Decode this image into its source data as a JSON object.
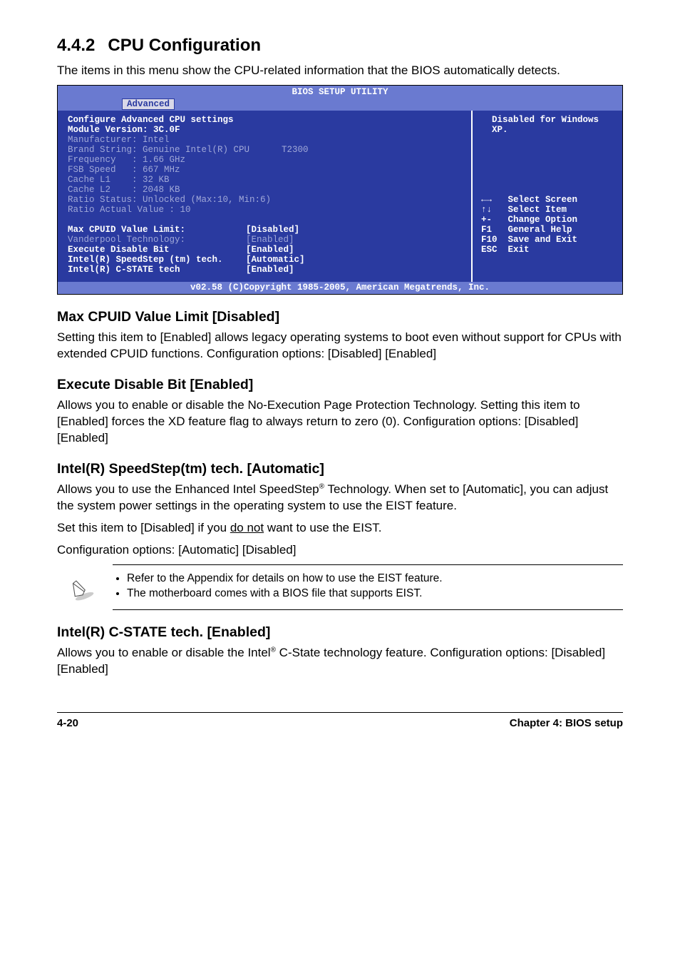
{
  "heading": {
    "num": "4.4.2",
    "title": "CPU Configuration"
  },
  "intro": "The items in this menu show the CPU-related information that the BIOS automatically detects.",
  "bios": {
    "headerTitle": "BIOS SETUP UTILITY",
    "tab": "Advanced",
    "cfg1": "Configure Advanced CPU settings",
    "cfg2": "Module Version: 3C.0F",
    "grey": [
      "Manufacturer: Intel",
      "Brand String: Genuine Intel(R) CPU      T2300",
      "Frequency   : 1.66 GHz",
      "FSB Speed   : 667 MHz",
      "Cache L1    : 32 KB",
      "Cache L2    : 2048 KB",
      "Ratio Status: Unlocked (Max:10, Min:6)",
      "Ratio Actual Value : 10"
    ],
    "rows": [
      {
        "label": "Max CPUID Value Limit:",
        "value": "[Disabled]",
        "style": "white"
      },
      {
        "label": "Vanderpool Technology:",
        "value": "[Enabled]",
        "style": "grey"
      },
      {
        "label": "Execute Disable Bit",
        "value": "[Enabled]",
        "style": "white"
      },
      {
        "label": "Intel(R) SpeedStep (tm) tech.",
        "value": "[Automatic]",
        "style": "white"
      },
      {
        "label": "Intel(R) C-STATE tech",
        "value": "[Enabled]",
        "style": "white"
      }
    ],
    "rightTop": "  Disabled for Windows\n  XP.",
    "rightNav": [
      {
        "key": "←→",
        "text": "Select Screen"
      },
      {
        "key": "↑↓",
        "text": "Select Item"
      },
      {
        "key": "+-",
        "text": "Change Option"
      },
      {
        "key": "F1",
        "text": "General Help"
      },
      {
        "key": "F10",
        "text": "Save and Exit"
      },
      {
        "key": "ESC",
        "text": "Exit"
      }
    ],
    "footer": "v02.58 (C)Copyright 1985-2005, American Megatrends, Inc."
  },
  "s1": {
    "title": "Max CPUID Value Limit [Disabled]",
    "body": "Setting this item to [Enabled] allows legacy operating systems to boot even without support for CPUs with extended CPUID functions. Configuration options: [Disabled] [Enabled]"
  },
  "s2": {
    "title": "Execute Disable Bit [Enabled]",
    "body": "Allows you to enable or disable the No-Execution Page Protection Technology. Setting this item to [Enabled] forces the XD feature flag to always return to zero (0). Configuration options: [Disabled] [Enabled]"
  },
  "s3": {
    "title": "Intel(R) SpeedStep(tm) tech. [Automatic]",
    "p1a": "Allows you to use the Enhanced Intel SpeedStep",
    "p1b": " Technology. When set to [Automatic], you can adjust the system power settings in the operating system to use the EIST feature.",
    "p2a": "Set this item to [Disabled] if you ",
    "p2u": "do not",
    "p2b": " want to use the EIST.",
    "p3": "Configuration options: [Automatic] [Disabled]"
  },
  "notes": [
    "Refer to the Appendix for details on how to use the EIST feature.",
    "The motherboard comes with a BIOS file that supports EIST."
  ],
  "s4": {
    "title": "Intel(R) C-STATE tech. [Enabled]",
    "p1a": "Allows you to enable or disable the Intel",
    "p1b": " C-State technology feature. Configuration options: [Disabled] [Enabled]"
  },
  "footer": {
    "left": "4-20",
    "right": "Chapter 4: BIOS setup"
  },
  "reg": "®"
}
